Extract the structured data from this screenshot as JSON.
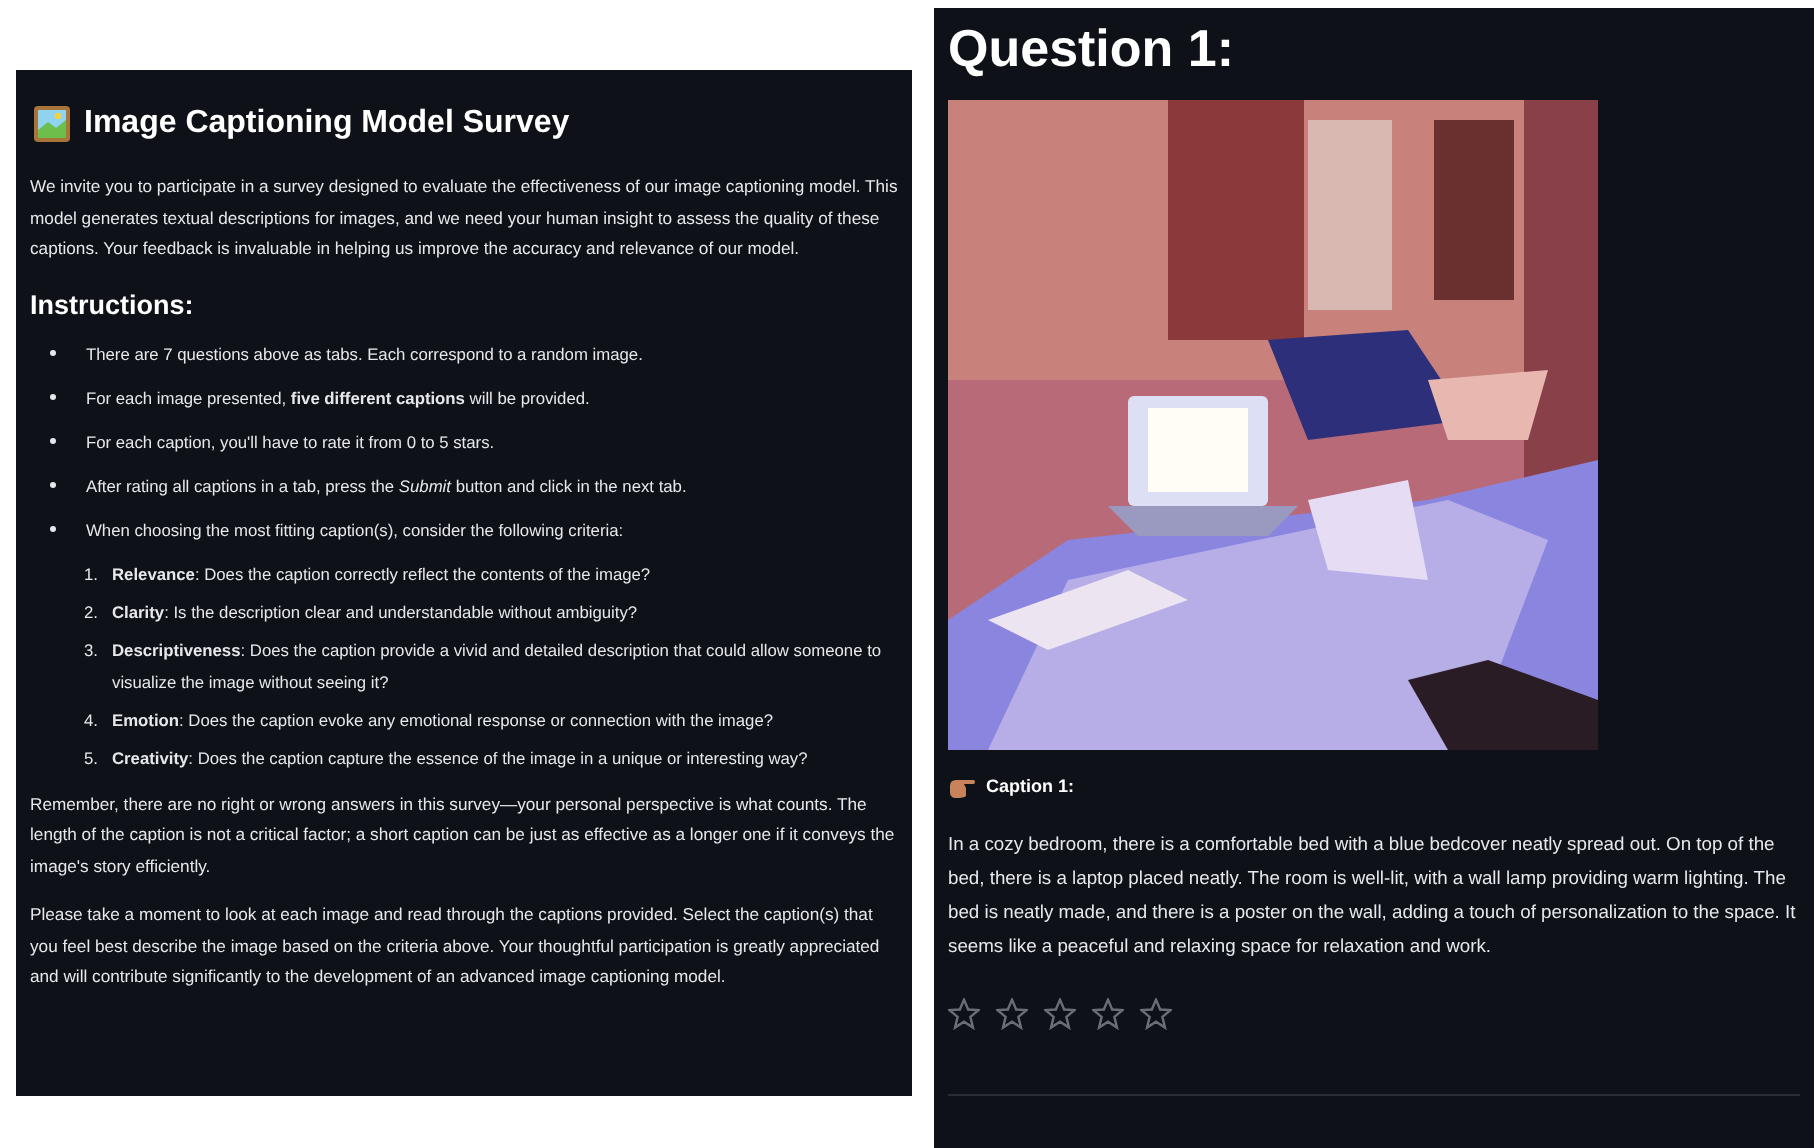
{
  "intro": {
    "title": "Image Captioning Model Survey",
    "description": "We invite you to participate in a survey designed to evaluate the effectiveness of our image captioning model. This model generates textual descriptions for images, and we need your human insight to assess the quality of these captions. Your feedback is invaluable in helping us improve the accuracy and relevance of our model.",
    "instructions_heading": "Instructions:",
    "bullets": [
      "There are 7 questions above as tabs. Each correspond to a random image.",
      "For each image presented, **five different captions** will be provided.",
      "For each caption, you'll have to rate it from 0 to 5 stars.",
      "After rating all captions in a tab, press the *Submit* button and click in the next tab.",
      "When choosing the most fitting caption(s), consider the following criteria:"
    ],
    "criteria": [
      {
        "number": "1.",
        "text": "**Relevance**: Does the caption correctly reflect the contents of the image?"
      },
      {
        "number": "2.",
        "text": "**Clarity**: Is the description clear and understandable without ambiguity?"
      },
      {
        "number": "3.",
        "text": "**Descriptiveness**: Does the caption provide a vivid and detailed description that could allow someone to visualize the image without seeing it?"
      },
      {
        "number": "4.",
        "text": "**Emotion**: Does the caption evoke any emotional response or connection with the image?"
      },
      {
        "number": "5.",
        "text": "**Creativity**: Does the caption capture the essence of the image in a unique or interesting way?"
      }
    ],
    "closing": [
      "Remember, there are no right or wrong answers in this survey—your personal perspective is what counts. The length of the caption is not a critical factor; a short caption can be just as effective as a longer one if it conveys the image's story efficiently.",
      "Please take a moment to look at each image and read through the captions provided. Select the caption(s) that you feel best describe the image based on the criteria above. Your thoughtful participation is greatly appreciated and will contribute significantly to the development of an advanced image captioning model."
    ]
  },
  "question": {
    "title": "Question 1:",
    "captions": [
      {
        "label": "Caption 1:",
        "text": "In a cozy bedroom, there is a comfortable bed with a blue bedcover neatly spread out. On top of the bed, there is a laptop placed neatly. The room is well-lit, with a wall lamp providing warm lighting. The bed is neatly made, and there is a poster on the wall, adding a touch of personalization to the space. It seems like a peaceful and relaxing space for relaxation and work.",
        "stars": 0
      }
    ]
  }
}
